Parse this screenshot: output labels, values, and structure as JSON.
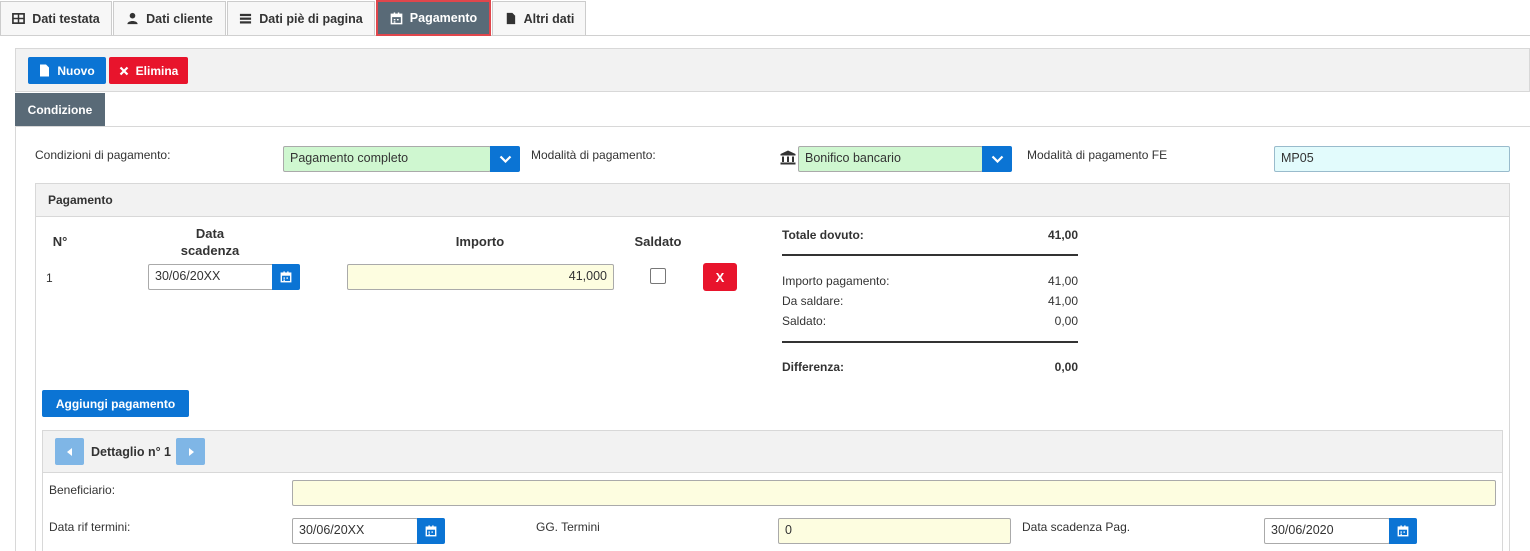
{
  "tabs": [
    {
      "label": "Dati testata",
      "icon": "table-icon"
    },
    {
      "label": "Dati cliente",
      "icon": "user-icon"
    },
    {
      "label": "Dati piè di pagina",
      "icon": "list-icon"
    },
    {
      "label": "Pagamento",
      "icon": "calendar-icon",
      "active": true
    },
    {
      "label": "Altri dati",
      "icon": "file-icon"
    }
  ],
  "toolbar": {
    "new_label": "Nuovo",
    "delete_label": "Elimina"
  },
  "subtab": {
    "label": "Condizione"
  },
  "conditions": {
    "cond_label": "Condizioni di pagamento:",
    "cond_value": "Pagamento completo",
    "mode_label": "Modalità di pagamento:",
    "mode_value": "Bonifico bancario",
    "fe_label": "Modalità di pagamento FE",
    "fe_value": "MP05"
  },
  "payment": {
    "title": "Pagamento",
    "headers": {
      "n": "N°",
      "due_line1": "Data",
      "due_line2": "scadenza",
      "amount": "Importo",
      "paid": "Saldato"
    },
    "rows": [
      {
        "n": "1",
        "due": "30/06/20XX",
        "amount": "41,000",
        "paid": false,
        "delete_label": "X"
      }
    ],
    "add_label": "Aggiungi pagamento"
  },
  "summary": {
    "total_label": "Totale dovuto:",
    "total_value": "41,00",
    "amount_label": "Importo pagamento:",
    "amount_value": "41,00",
    "due_label": "Da saldare:",
    "due_value": "41,00",
    "paid_label": "Saldato:",
    "paid_value": "0,00",
    "diff_label": "Differenza:",
    "diff_value": "0,00"
  },
  "detail": {
    "title": "Dettaglio n° 1",
    "beneficiary_label": "Beneficiario:",
    "beneficiary_value": "",
    "ref_date_label": "Data rif termini:",
    "ref_date_value": "30/06/20XX",
    "days_label": "GG. Termini",
    "days_value": "0",
    "due_date_label": "Data scadenza Pag.",
    "due_date_value": "30/06/2020"
  },
  "colors": {
    "primary": "#0b74d4",
    "danger": "#e8142c",
    "active_tab": "#596a77",
    "green_field": "#cff7d0",
    "yellow_field": "#fdfde0"
  }
}
